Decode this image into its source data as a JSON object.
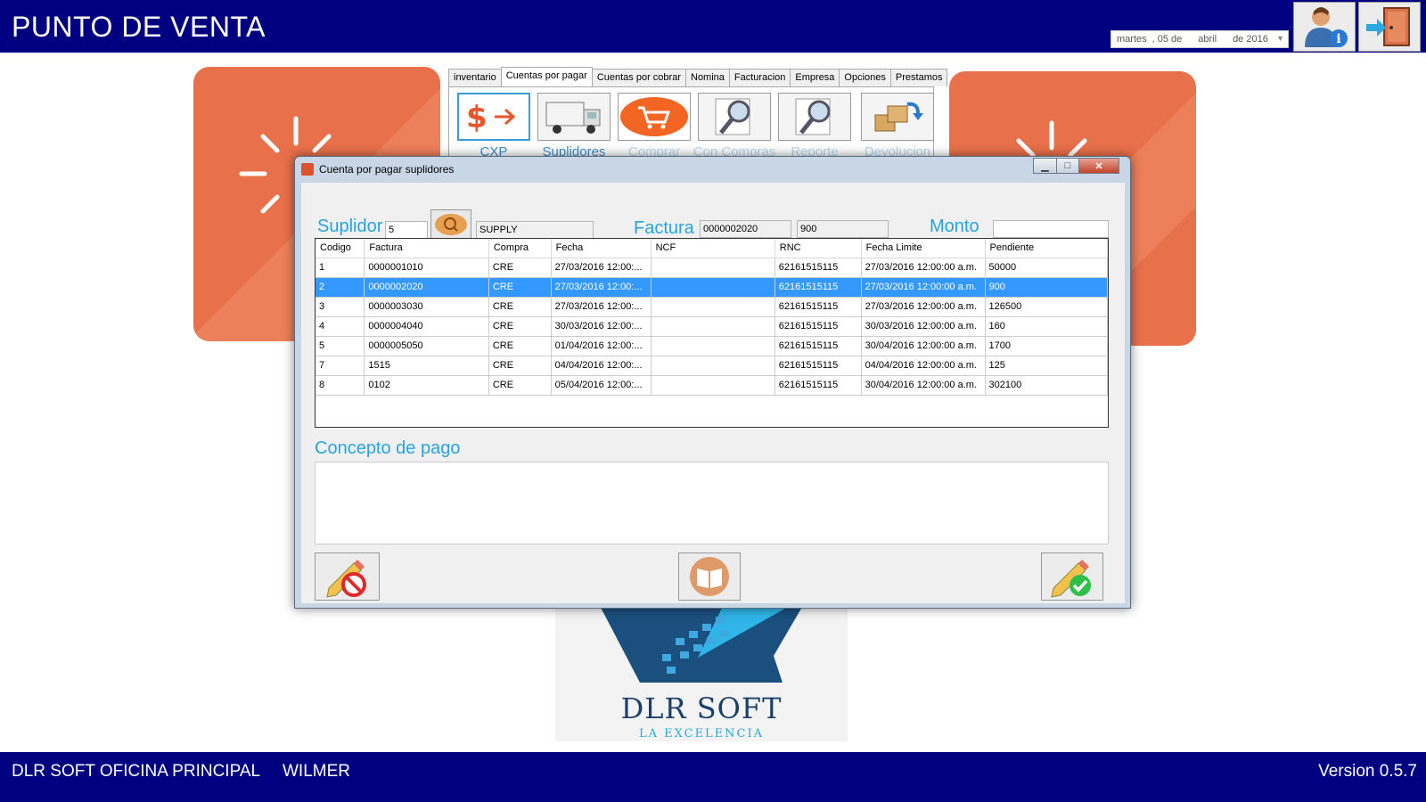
{
  "app": {
    "title": "PUNTO DE VENTA",
    "date": {
      "weekday": "martes",
      "day": ", 05 de",
      "month": "abril",
      "year": "de 2016"
    }
  },
  "topbar": {
    "user_button_icon": "user-info-icon",
    "exit_button_icon": "exit-door-icon"
  },
  "tabs": [
    "inventario",
    "Cuentas por pagar",
    "Cuentas por cobrar",
    "Nomina",
    "Facturacion",
    "Empresa",
    "Opciones",
    "Prestamos"
  ],
  "active_tab": "Cuentas por pagar",
  "toolbar": {
    "items": [
      {
        "label": "CXP",
        "icon": "dollar-arrow-icon"
      },
      {
        "label": "Suplidores",
        "icon": "truck-icon"
      },
      {
        "label": "Comprar",
        "icon": "cart-icon"
      },
      {
        "label": "Con Compras",
        "icon": "magnifier-icon"
      },
      {
        "label": "Reporte",
        "icon": "magnifier-report-icon"
      },
      {
        "label": "Devolucion",
        "icon": "boxes-return-icon"
      }
    ]
  },
  "dialog": {
    "title": "Cuenta por pagar suplidores",
    "suplidor_label": "Suplidor",
    "suplidor_id": "5",
    "suplidor_name": "SUPPLY",
    "factura_label": "Factura",
    "factura_value": "0000002020",
    "factura_amount": "900",
    "monto_label": "Monto",
    "monto_value": "",
    "concepto_label": "Concepto de pago",
    "concepto_value": "",
    "columns": [
      "Codigo",
      "Factura",
      "Compra",
      "Fecha",
      "NCF",
      "RNC",
      "Fecha Limite",
      "Pendiente"
    ],
    "rows": [
      [
        "1",
        "0000001010",
        "CRE",
        "27/03/2016 12:00:...",
        "",
        "62161515115",
        "27/03/2016 12:00:00 a.m.",
        "50000"
      ],
      [
        "2",
        "0000002020",
        "CRE",
        "27/03/2016 12:00:...",
        "",
        "62161515115",
        "27/03/2016 12:00:00 a.m.",
        "900"
      ],
      [
        "3",
        "0000003030",
        "CRE",
        "27/03/2016 12:00:...",
        "",
        "62161515115",
        "27/03/2016 12:00:00 a.m.",
        "126500"
      ],
      [
        "4",
        "0000004040",
        "CRE",
        "30/03/2016 12:00:...",
        "",
        "62161515115",
        "30/03/2016 12:00:00 a.m.",
        "160"
      ],
      [
        "5",
        "0000005050",
        "CRE",
        "01/04/2016 12:00:...",
        "",
        "62161515115",
        "30/04/2016 12:00:00 a.m.",
        "1700"
      ],
      [
        "7",
        "1515",
        "CRE",
        "04/04/2016 12:00:...",
        "",
        "62161515115",
        "04/04/2016 12:00:00 a.m.",
        "125"
      ],
      [
        "8",
        "0102",
        "CRE",
        "05/04/2016 12:00:...",
        "",
        "62161515115",
        "30/04/2016 12:00:00 a.m.",
        "302100"
      ]
    ],
    "selected_row": 1
  },
  "logo": {
    "name": "DLR SOFT",
    "tagline": "LA EXCELENCIA"
  },
  "status": {
    "office": "DLR SOFT OFICINA PRINCIPAL",
    "user": "WILMER",
    "version": "Version 0.5.7"
  },
  "colors": {
    "header_bg": "#000080",
    "accent_blue": "#29a3e0",
    "tile_orange": "#e8704a",
    "selection": "#3399ff"
  }
}
